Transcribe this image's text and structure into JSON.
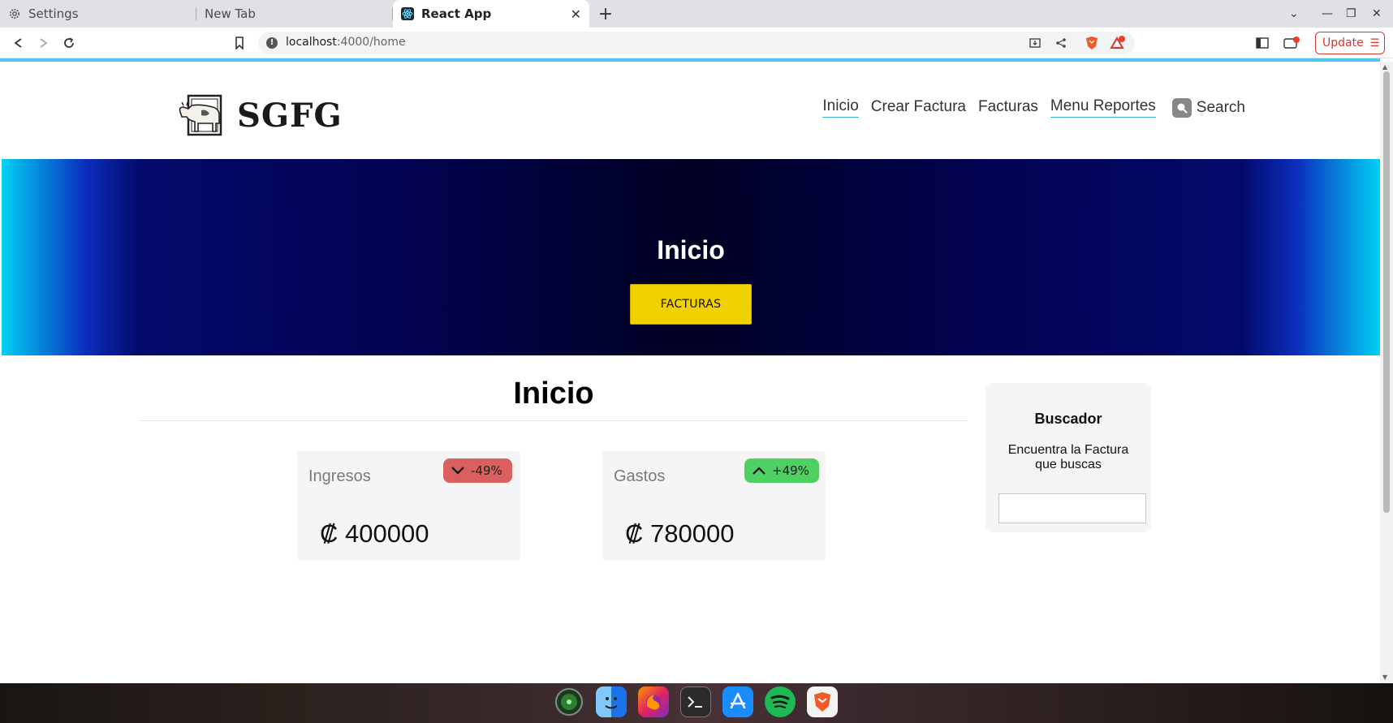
{
  "browser": {
    "tabs": [
      {
        "title": "Settings",
        "icon": "gear-icon",
        "active": false
      },
      {
        "title": "New Tab",
        "icon": "",
        "active": false
      },
      {
        "title": "React App",
        "icon": "react-icon",
        "active": true
      }
    ],
    "new_tab_label": "+",
    "url": {
      "host": "localhost",
      "path": ":4000/home"
    },
    "update_label": "Update"
  },
  "site": {
    "logo_text": "SGFG",
    "nav": {
      "items": [
        "Inicio",
        "Crear Factura",
        "Facturas",
        "Menu Reportes"
      ],
      "search_label": "Search"
    },
    "hero": {
      "title": "Inicio",
      "button_label": "FACTURAS"
    },
    "main": {
      "title": "Inicio",
      "cards": [
        {
          "label": "Ingresos",
          "badge": "-49%",
          "trend": "down",
          "value": "₡ 400000",
          "badge_color": "#d9605f"
        },
        {
          "label": "Gastos",
          "badge": "+49%",
          "trend": "up",
          "value": "₡ 780000",
          "badge_color": "#4fd062"
        }
      ]
    },
    "sidebar": {
      "title": "Buscador",
      "text": "Encuentra la Factura que buscas",
      "input_value": ""
    }
  },
  "dock": {
    "apps": [
      "radar-icon",
      "finder-icon",
      "firefox-icon",
      "terminal-icon",
      "app-store-icon",
      "spotify-icon",
      "brave-icon"
    ]
  },
  "colors": {
    "accent_underline": "#36b4e0",
    "hero_button": "#f2d100",
    "update_red": "#d9362b"
  }
}
